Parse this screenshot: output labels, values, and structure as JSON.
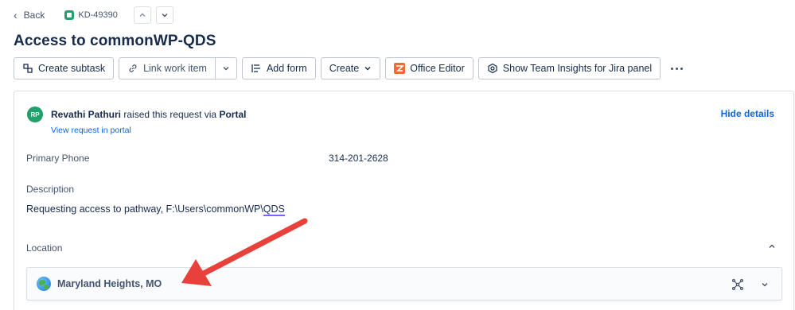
{
  "nav": {
    "back_label": "Back",
    "issue_key": "KD-49390"
  },
  "issue": {
    "title": "Access to commonWP-QDS"
  },
  "toolbar": {
    "create_subtask": "Create subtask",
    "link_work_item": "Link work item",
    "add_form": "Add form",
    "create": "Create",
    "office_editor": "Office Editor",
    "team_insights": "Show Team Insights for Jira panel"
  },
  "request": {
    "avatar_initials": "RP",
    "requester_name": "Revathi Pathuri",
    "raised_text": " raised this request via ",
    "channel": "Portal",
    "view_link": "View request in portal",
    "hide_details": "Hide details"
  },
  "fields": {
    "primary_phone_label": "Primary Phone",
    "primary_phone_value": "314-201-2628",
    "description_label": "Description",
    "description_prefix": "Requesting access to pathway, F:\\Users\\commonWP\\",
    "description_underlined": "QDS",
    "location_label": "Location",
    "location_value": "Maryland Heights, MO"
  },
  "colors": {
    "accent_link": "#0c66e4",
    "avatar_bg": "#22a06b",
    "annotation_arrow": "#e8413c"
  },
  "icons": [
    "back-chevron-icon",
    "issue-type-icon",
    "chevron-up-icon",
    "chevron-down-icon",
    "subtask-icon",
    "link-icon",
    "form-icon",
    "office-editor-icon",
    "team-insights-icon",
    "more-icon",
    "globe-icon",
    "map-icon"
  ]
}
